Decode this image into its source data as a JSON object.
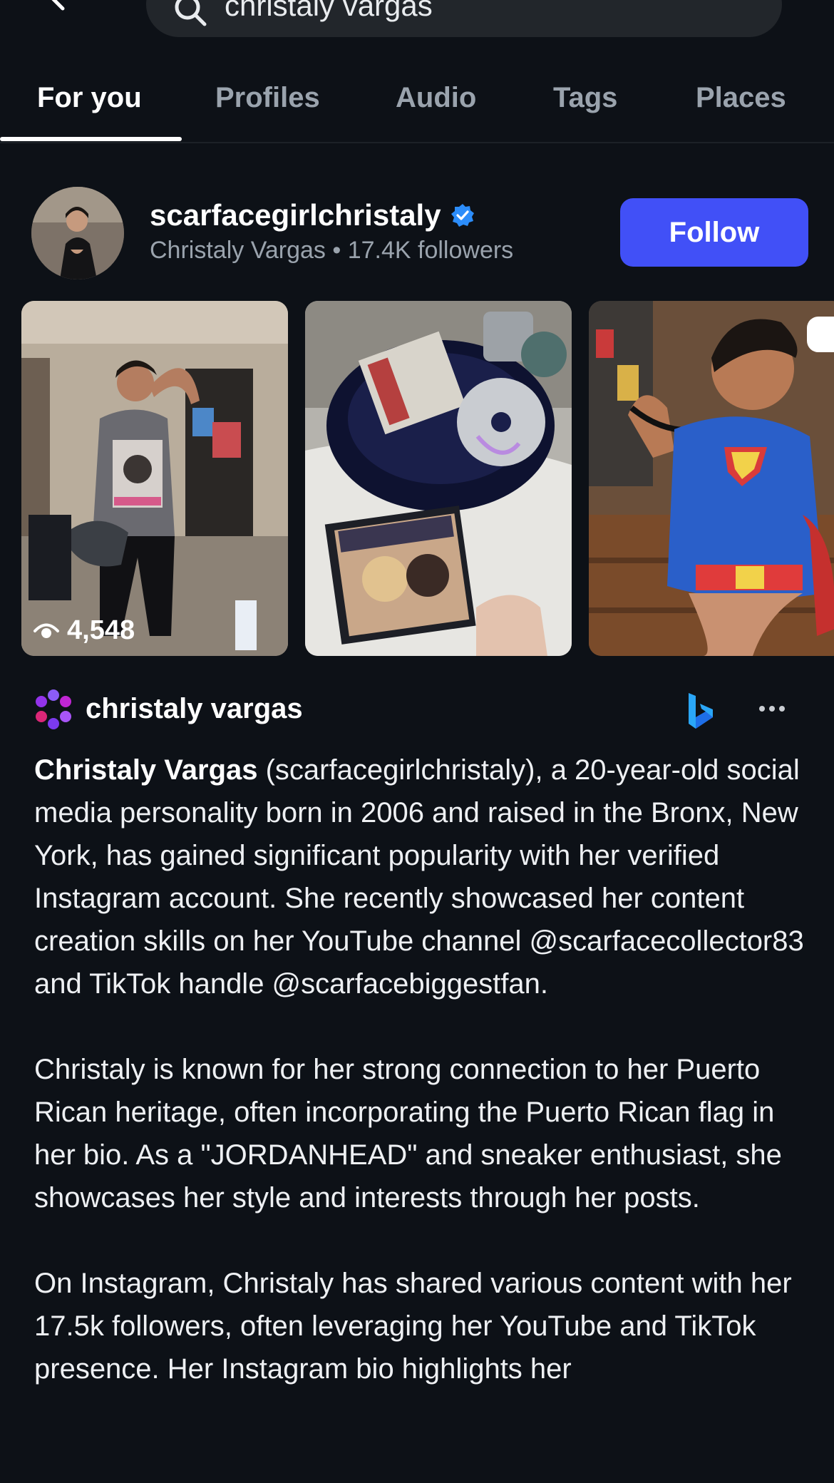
{
  "search": {
    "query": "christaly vargas"
  },
  "tabs": [
    {
      "label": "For you",
      "active": true
    },
    {
      "label": "Profiles",
      "active": false
    },
    {
      "label": "Audio",
      "active": false
    },
    {
      "label": "Tags",
      "active": false
    },
    {
      "label": "Places",
      "active": false
    }
  ],
  "profile": {
    "username": "scarfacegirlchristaly",
    "verified": true,
    "full_name": "Christaly Vargas",
    "separator": "•",
    "followers": "17.4K followers",
    "follow_label": "Follow",
    "accent": "#4150f7"
  },
  "thumbnails": [
    {
      "views": "4,548",
      "subject": "woman in graphic tee"
    },
    {
      "subject": "cd player and grease cd"
    },
    {
      "subject": "woman in superman shirt"
    }
  ],
  "ai_summary": {
    "title": "christaly vargas",
    "bold_name": "Christaly Vargas",
    "p1_rest": " (scarfacegirlchristaly), a 20-year-old social media personality born in 2006 and raised in the Bronx, New York, has gained significant popularity with her verified Instagram account. She recently showcased her content creation skills on her YouTube channel @scarfacecollector83 and TikTok handle @scarfacebiggestfan.",
    "p2": "Christaly is known for her strong connection to her Puerto Rican heritage, often incorporating the Puerto Rican flag in her bio. As a \"JORDANHEAD\" and sneaker enthusiast, she showcases her style and interests through her posts.",
    "p3": "On Instagram, Christaly has shared various content with her 17.5k followers, often leveraging her YouTube and TikTok presence. Her Instagram bio highlights her"
  }
}
